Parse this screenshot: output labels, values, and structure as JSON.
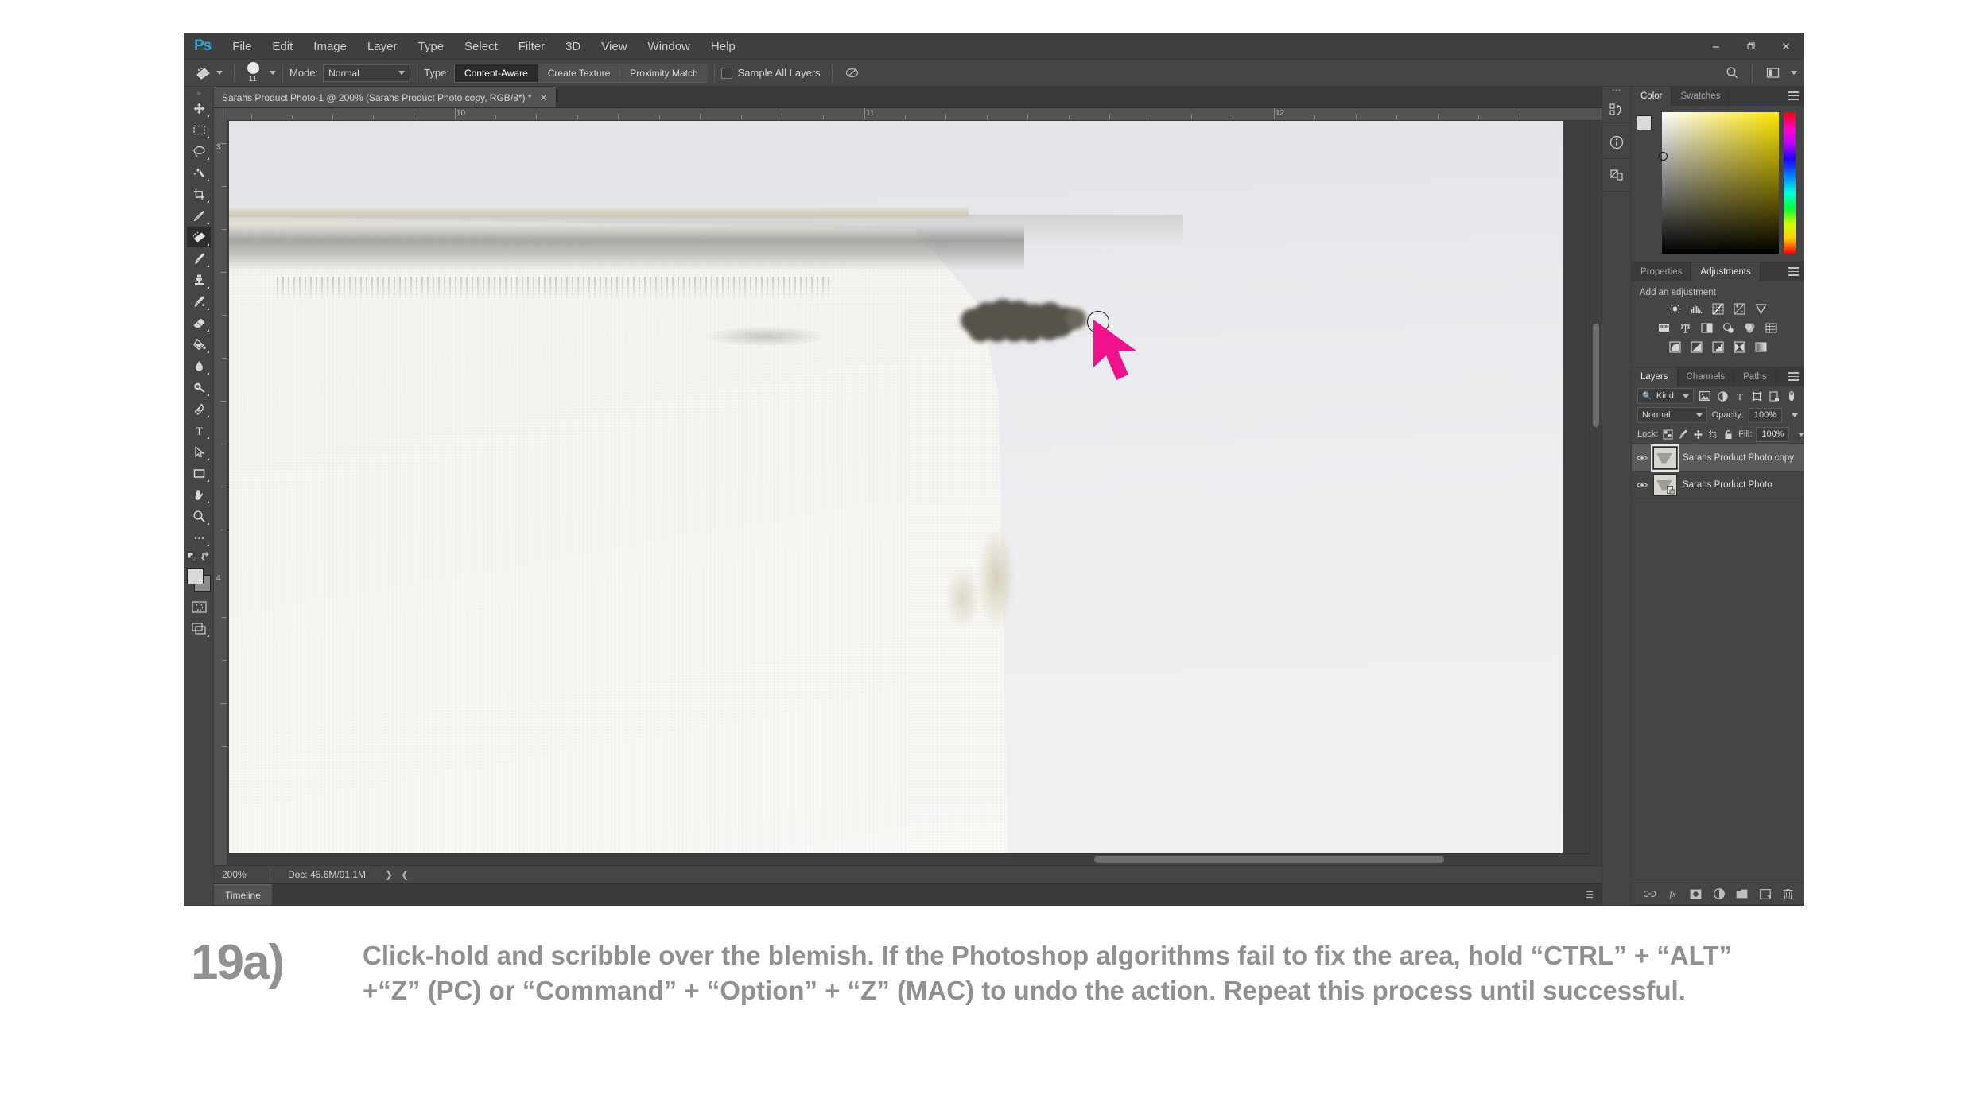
{
  "app": {
    "logo": "Ps",
    "menus": [
      "File",
      "Edit",
      "Image",
      "Layer",
      "Type",
      "Select",
      "Filter",
      "3D",
      "View",
      "Window",
      "Help"
    ],
    "window_controls": {
      "minimize": "—",
      "restore": "❐",
      "close": "✕"
    }
  },
  "options_bar": {
    "tool_icon": "spot-healing-brush-icon",
    "brush_size": "11",
    "mode_label": "Mode:",
    "mode_value": "Normal",
    "type_label": "Type:",
    "type_options": [
      "Content-Aware",
      "Create Texture",
      "Proximity Match"
    ],
    "type_selected": "Content-Aware",
    "sample_all_layers_label": "Sample All Layers",
    "sample_all_layers_checked": false,
    "pressure_icon": "pressure-size-icon",
    "search_icon": "search-icon",
    "workspace_icon": "workspace-switcher-icon"
  },
  "toolbox": {
    "tools": [
      {
        "name": "move-tool",
        "icon": "move-icon",
        "active": false
      },
      {
        "name": "rectangular-marquee-tool",
        "icon": "marquee-icon",
        "active": false
      },
      {
        "name": "lasso-tool",
        "icon": "lasso-icon",
        "active": false
      },
      {
        "name": "quick-selection-tool",
        "icon": "magic-wand-icon",
        "active": false
      },
      {
        "name": "crop-tool",
        "icon": "crop-icon",
        "active": false
      },
      {
        "name": "eyedropper-tool",
        "icon": "eyedropper-icon",
        "active": false
      },
      {
        "name": "spot-healing-brush-tool",
        "icon": "healing-brush-icon",
        "active": true
      },
      {
        "name": "brush-tool",
        "icon": "brush-icon",
        "active": false
      },
      {
        "name": "clone-stamp-tool",
        "icon": "clone-stamp-icon",
        "active": false
      },
      {
        "name": "history-brush-tool",
        "icon": "history-brush-icon",
        "active": false
      },
      {
        "name": "eraser-tool",
        "icon": "eraser-icon",
        "active": false
      },
      {
        "name": "gradient-tool",
        "icon": "paint-bucket-icon",
        "active": false
      },
      {
        "name": "blur-tool",
        "icon": "blur-drop-icon",
        "active": false
      },
      {
        "name": "dodge-tool",
        "icon": "dodge-icon",
        "active": false
      },
      {
        "name": "pen-tool",
        "icon": "pen-icon",
        "active": false
      },
      {
        "name": "type-tool",
        "icon": "type-icon",
        "active": false
      },
      {
        "name": "path-selection-tool",
        "icon": "path-arrow-icon",
        "active": false
      },
      {
        "name": "rectangle-tool",
        "icon": "rectangle-icon",
        "active": false
      },
      {
        "name": "hand-tool",
        "icon": "hand-icon",
        "active": false
      },
      {
        "name": "zoom-tool",
        "icon": "magnifier-icon",
        "active": false
      },
      {
        "name": "edit-toolbar",
        "icon": "ellipsis-icon",
        "active": false
      }
    ],
    "foreground_color": "#d9d9d9",
    "background_color": "#8e8e8e",
    "quick_mask_icon": "quick-mask-icon",
    "screen_mode_icon": "screen-mode-icon"
  },
  "document": {
    "tab_title": "Sarahs Product Photo-1 @ 200%  (Sarahs Product Photo copy, RGB/8*) *",
    "close_icon": "close-icon",
    "ruler_h_labels": [
      "10",
      "11",
      "12"
    ],
    "ruler_v_labels": [
      "3",
      "4"
    ]
  },
  "status_bar": {
    "zoom": "200%",
    "doc_info": "Doc: 45.6M/91.1M"
  },
  "timeline": {
    "tab_label": "Timeline"
  },
  "dock_strip": [
    {
      "name": "history-panel-icon",
      "label": "history-icon"
    },
    {
      "name": "info-panel-icon",
      "label": "info-icon"
    },
    {
      "name": "libraries-panel-icon",
      "label": "libraries-icon"
    }
  ],
  "color_panel": {
    "tabs": [
      "Color",
      "Swatches"
    ],
    "active_tab": "Color",
    "menu_icon": "panel-menu-icon",
    "foreground_color": "#d9d9d9",
    "background_color": "#8e8e8e",
    "hue_selected": "#ffe600"
  },
  "adjustments_panel": {
    "tabs": [
      "Properties",
      "Adjustments"
    ],
    "active_tab": "Adjustments",
    "menu_icon": "panel-menu-icon",
    "title": "Add an adjustment",
    "rows": [
      [
        "brightness-contrast-icon",
        "levels-icon",
        "curves-icon",
        "exposure-icon",
        "vibrance-icon"
      ],
      [
        "hue-saturation-icon",
        "color-balance-icon",
        "black-white-icon",
        "photo-filter-icon",
        "channel-mixer-icon",
        "color-lookup-icon"
      ],
      [
        "invert-icon",
        "posterize-icon",
        "threshold-icon",
        "selective-color-icon",
        "gradient-map-icon"
      ]
    ]
  },
  "layers_panel": {
    "tabs": [
      "Layers",
      "Channels",
      "Paths"
    ],
    "active_tab": "Layers",
    "menu_icon": "panel-menu-icon",
    "filter_label": "Kind",
    "filter_icon": "search-icon",
    "filter_type_icons": [
      "pixel-filter-icon",
      "adjustment-filter-icon",
      "type-filter-icon",
      "shape-filter-icon",
      "smart-object-filter-icon"
    ],
    "filter_toggle_icon": "filter-toggle-icon",
    "blend_mode": "Normal",
    "opacity_label": "Opacity:",
    "opacity_value": "100%",
    "lock_label": "Lock:",
    "lock_icons": [
      "lock-transparency-icon",
      "lock-image-icon",
      "lock-position-icon",
      "lock-artboard-icon",
      "lock-all-icon"
    ],
    "fill_label": "Fill:",
    "fill_value": "100%",
    "layers": [
      {
        "name": "Sarahs Product Photo copy",
        "visible": true,
        "selected": true,
        "eye_icon": "eye-icon"
      },
      {
        "name": "Sarahs Product Photo",
        "visible": true,
        "selected": false,
        "eye_icon": "eye-icon"
      }
    ],
    "bottom_icons": [
      "link-layers-icon",
      "layer-style-fx-icon",
      "add-mask-icon",
      "new-adjustment-icon",
      "new-group-icon",
      "new-layer-icon",
      "delete-layer-icon"
    ]
  },
  "canvas": {
    "cursor_icon": "brush-circle-cursor",
    "pointer_icon": "arrow-pointer-icon",
    "pointer_color": "#f0128c",
    "scribble_color": "#56534a"
  },
  "caption": {
    "number": "19a)",
    "text": "Click-hold and scribble over the blemish. If the Photoshop algorithms fail to fix the area, hold “CTRL” + “ALT” +“Z” (PC) or “Command” + “Option” + “Z” (MAC) to undo the action. Repeat this process until successful.",
    "color": "#8e9092"
  }
}
